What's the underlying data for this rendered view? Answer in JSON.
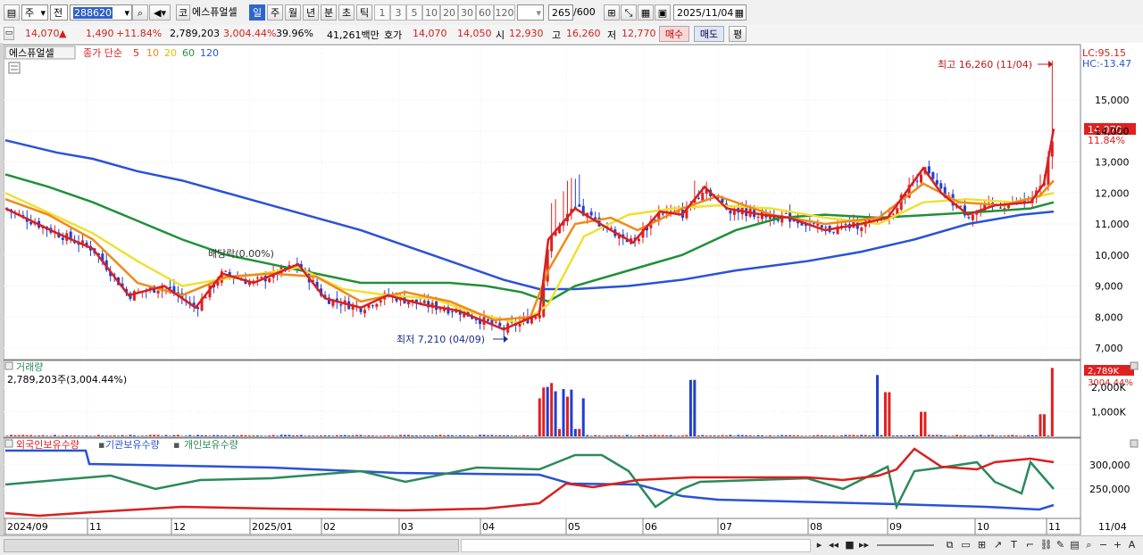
{
  "toolbar": {
    "market": "주",
    "prev_label": "전",
    "code": "288620",
    "market_short": "코",
    "stock_name": "에스퓨얼셀",
    "periods": [
      "일",
      "주",
      "월",
      "년",
      "분",
      "초",
      "틱"
    ],
    "selected_period": "일",
    "intervals": [
      "1",
      "3",
      "5",
      "10",
      "20",
      "30",
      "60",
      "120"
    ],
    "count": "265",
    "total": "/600",
    "date": "2025/11/04"
  },
  "quote": {
    "price": "14,070",
    "change_arrow": "▲",
    "change": "1,490",
    "change_pct": "+11.84%",
    "volume": "2,789,203",
    "volume_pct": "3,004.44%",
    "turnover": "39.96%",
    "amount": "41,261백만",
    "bid_label": "호가",
    "ask": "14,070",
    "bid": "14,050",
    "open_label": "시",
    "open": "12,930",
    "high_label": "고",
    "high": "16,260",
    "low_label": "저",
    "low": "12,770",
    "buy_button": "매수",
    "sell_button": "매도",
    "avg_button": "평"
  },
  "price_panel": {
    "name_tag": "에스퓨얼셀",
    "ma_title": "종가 단순",
    "ma_periods": [
      "5",
      "10",
      "20",
      "60",
      "120"
    ],
    "ma_colors": [
      "#d82020",
      "#ef8a1a",
      "#f0e030",
      "#20903a",
      "#2a52d8"
    ],
    "lc": "LC:95.15",
    "hc": "HC:-13.47",
    "high_annotation": "최고 16,260 (11/04)",
    "low_annotation": "최저 7,210 (04/09)",
    "dividend_annotation": "배당락(0.00%)",
    "current_price_tag": "14,070",
    "current_pct_tag": "11.84%",
    "y_labels": [
      "15,000",
      "14,000",
      "13,000",
      "12,000",
      "11,000",
      "10,000",
      "9,000",
      "8,000",
      "7,000"
    ]
  },
  "volume_panel": {
    "title": "거래량",
    "value": "2,789,203주(3,004.44%)",
    "tag_value": "2,789K",
    "tag_pct": "3004.44%",
    "y_labels": [
      "2,000K",
      "1,000K"
    ]
  },
  "holding_panel": {
    "legend": [
      {
        "name": "외국인보유수량",
        "color": "#d82020"
      },
      {
        "name": "기관보유수량",
        "color": "#2a52d8"
      },
      {
        "name": "개인보유수량",
        "color": "#2a8a5a"
      }
    ],
    "y_labels": [
      "300,000",
      "250,000"
    ]
  },
  "x_axis": {
    "labels": [
      "2024/09",
      "11",
      "12",
      "2025/01",
      "02",
      "03",
      "04",
      "05",
      "06",
      "07",
      "08",
      "09",
      "10",
      "11"
    ],
    "end_label": "11/04"
  }
}
